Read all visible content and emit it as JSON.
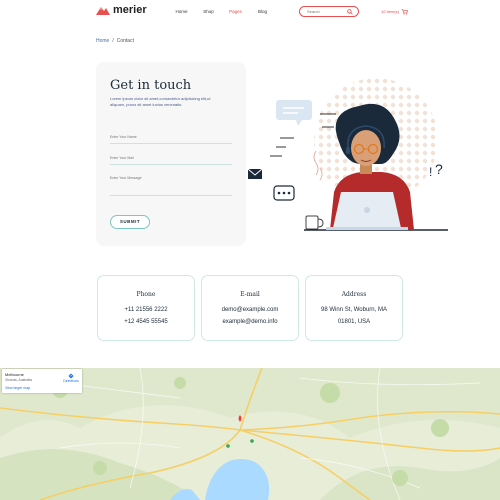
{
  "header": {
    "logo_text": "merier",
    "nav": [
      "Home",
      "Shop",
      "Pages",
      "Blog"
    ],
    "nav_active_index": 2,
    "search_placeholder": "Search",
    "cart_label": "10 Item(s)"
  },
  "breadcrumb": {
    "home": "Home",
    "separator": "/",
    "current": "Contact"
  },
  "form": {
    "title": "Get in touch",
    "description": "Lorem ipsum dolor sit amet,consectetur adipisicing elit,ut aliquam, purus sit amet luctus venenatis.",
    "name_placeholder": "Enter Your Name",
    "email_placeholder": "Enter Your Mail",
    "message_placeholder": "Enter Your Message",
    "submit_label": "SUBMIT"
  },
  "contacts": [
    {
      "title": "Phone",
      "lines": [
        "+11 21556 2222",
        "+12 4545 55545"
      ]
    },
    {
      "title": "E-mail",
      "lines": [
        "demo@example.com",
        "example@demo.info"
      ]
    },
    {
      "title": "Address",
      "lines": [
        "98 Winn St, Woburn, MA",
        "01801, USA"
      ]
    }
  ],
  "map": {
    "place": "Melbourne",
    "region": "Victoria, Australia",
    "larger_map": "View larger map",
    "directions": "Directions"
  },
  "colors": {
    "accent": "#e84f4f",
    "teal": "#7ec6c2",
    "dark": "#1b2a3a"
  },
  "icons": {
    "logo": "mountain-logo-icon",
    "search": "search-icon",
    "cart": "cart-icon"
  }
}
